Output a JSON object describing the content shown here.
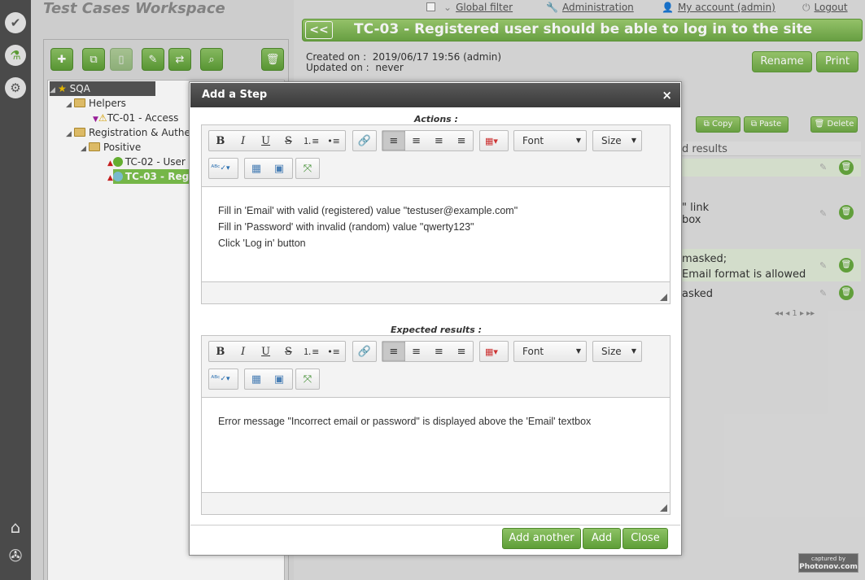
{
  "workspace": {
    "title": "Test Cases Workspace"
  },
  "nav": {
    "icons": [
      "check-icon",
      "flask-icon",
      "gears-icon",
      "home-icon",
      "tools-icon"
    ]
  },
  "toolbar": {
    "buttons": [
      "add-icon",
      "copy-icon",
      "paste-icon",
      "edit-icon",
      "swap-icon",
      "search-icon",
      "delete-icon"
    ]
  },
  "tree": {
    "root": "SQA",
    "helpers": "Helpers",
    "tc01": "TC-01 - Access",
    "registration": "Registration & Authe",
    "positive": "Positive",
    "tc02": "TC-02 - User",
    "tc03": "TC-03 - Reg"
  },
  "topbar": {
    "global_filter": "Global filter",
    "administration": "Administration",
    "my_account": "My account (admin)",
    "logout": "Logout"
  },
  "testcase": {
    "back": "<<",
    "title": "TC-03 - Registered user should be able to log in to the site",
    "created_label": "Created on :",
    "created_value": "2019/06/17 19:56 (admin)",
    "updated_label": "Updated on :",
    "updated_value": "never",
    "rename": "Rename",
    "print": "Print"
  },
  "steps": {
    "copy": "Copy",
    "paste": "Paste",
    "delete": "Delete",
    "column_expected": "d results",
    "row_texts": [
      "\" link",
      "box",
      "masked;",
      "Email format is allowed",
      "asked"
    ],
    "pager": "◂◂ ◂ 1 ▸ ▸▸"
  },
  "dialog": {
    "title": "Add a Step",
    "close": "×",
    "actions_label": "Actions :",
    "expected_label": "Expected results :",
    "font_dropdown": "Font",
    "size_dropdown": "Size",
    "actions_lines": [
      "Fill in 'Email' with valid (registered) value \"testuser@example.com\"",
      "Fill in 'Password' with invalid (random) value \"qwerty123\"",
      "Click 'Log in' button"
    ],
    "expected_text": "Error message \"Incorrect email or password\" is displayed above the 'Email' textbox",
    "add_another": "Add another",
    "add": "Add",
    "close_button": "Close"
  },
  "watermark": {
    "line1": "captured by",
    "line2": "Photonov.com"
  },
  "colors": {
    "accent": "#6ea846",
    "header": "#3a3a3a"
  }
}
